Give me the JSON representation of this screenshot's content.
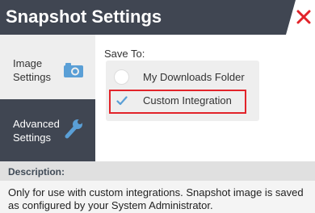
{
  "window": {
    "title": "Snapshot Settings",
    "close_icon": "close-x-icon",
    "accent_color": "#e2232a",
    "titlebar_color": "#404652"
  },
  "sidebar": {
    "items": [
      {
        "line1": "Image",
        "line2": "Settings",
        "icon": "camera-icon",
        "active": true
      },
      {
        "line1": "Advanced",
        "line2": "Settings",
        "icon": "wrench-icon",
        "active": false
      }
    ]
  },
  "save_to": {
    "label": "Save To:",
    "options": [
      {
        "label": "My Downloads Folder",
        "selected": false
      },
      {
        "label": "Custom Integration",
        "selected": true
      }
    ]
  },
  "description": {
    "title": "Description:",
    "text": "Only for use with custom integrations. Snapshot image is saved as configured by your System Administrator."
  }
}
